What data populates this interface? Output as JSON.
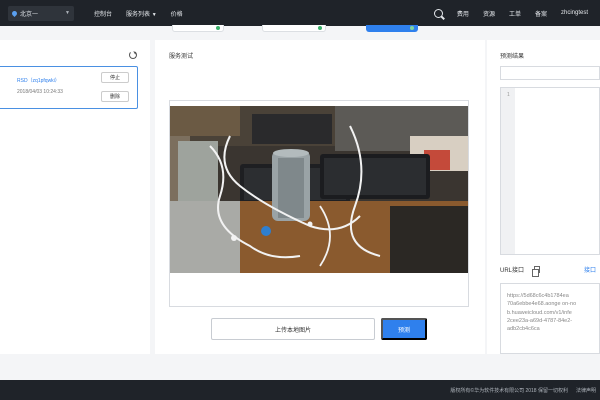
{
  "topbar": {
    "region": "北京一",
    "nav": [
      "控制台",
      "服务列表",
      "价格"
    ],
    "links": [
      "费用",
      "资源",
      "工单",
      "备案",
      "zhcingtest"
    ]
  },
  "left": {
    "card": {
      "name": "RSD（zq1pfqwki）",
      "time": "2018/04/03 10:24:33",
      "stop_label": "停止",
      "delete_label": "删除"
    }
  },
  "center": {
    "title": "服务测试",
    "upload_label": "上传本地图片",
    "predict_label": "预测"
  },
  "right": {
    "title": "预测结果",
    "line_number": "1",
    "url_label": "URL接口",
    "url_link": "接口",
    "url_lines": [
      "https://5d68c6c4b1784ea",
      "70a6ebbe4e68.aonge on-no",
      "b.huaweicloud.com/v1/infe",
      "2cee23a-a69d-4787-84e2-",
      "adb2cb4c6ca"
    ]
  },
  "footer": {
    "copyright": "版权所有©华为软件技术有限公司 2018 保留一切权利",
    "link": "法律声明"
  },
  "colors": {
    "topbar": "#1f2329",
    "accent": "#2f80ed",
    "background": "#f4f5f7"
  },
  "icons": [
    "location-pin-icon",
    "chevron-down-icon",
    "search-icon",
    "refresh-icon",
    "copy-icon",
    "status-dot-icon"
  ]
}
